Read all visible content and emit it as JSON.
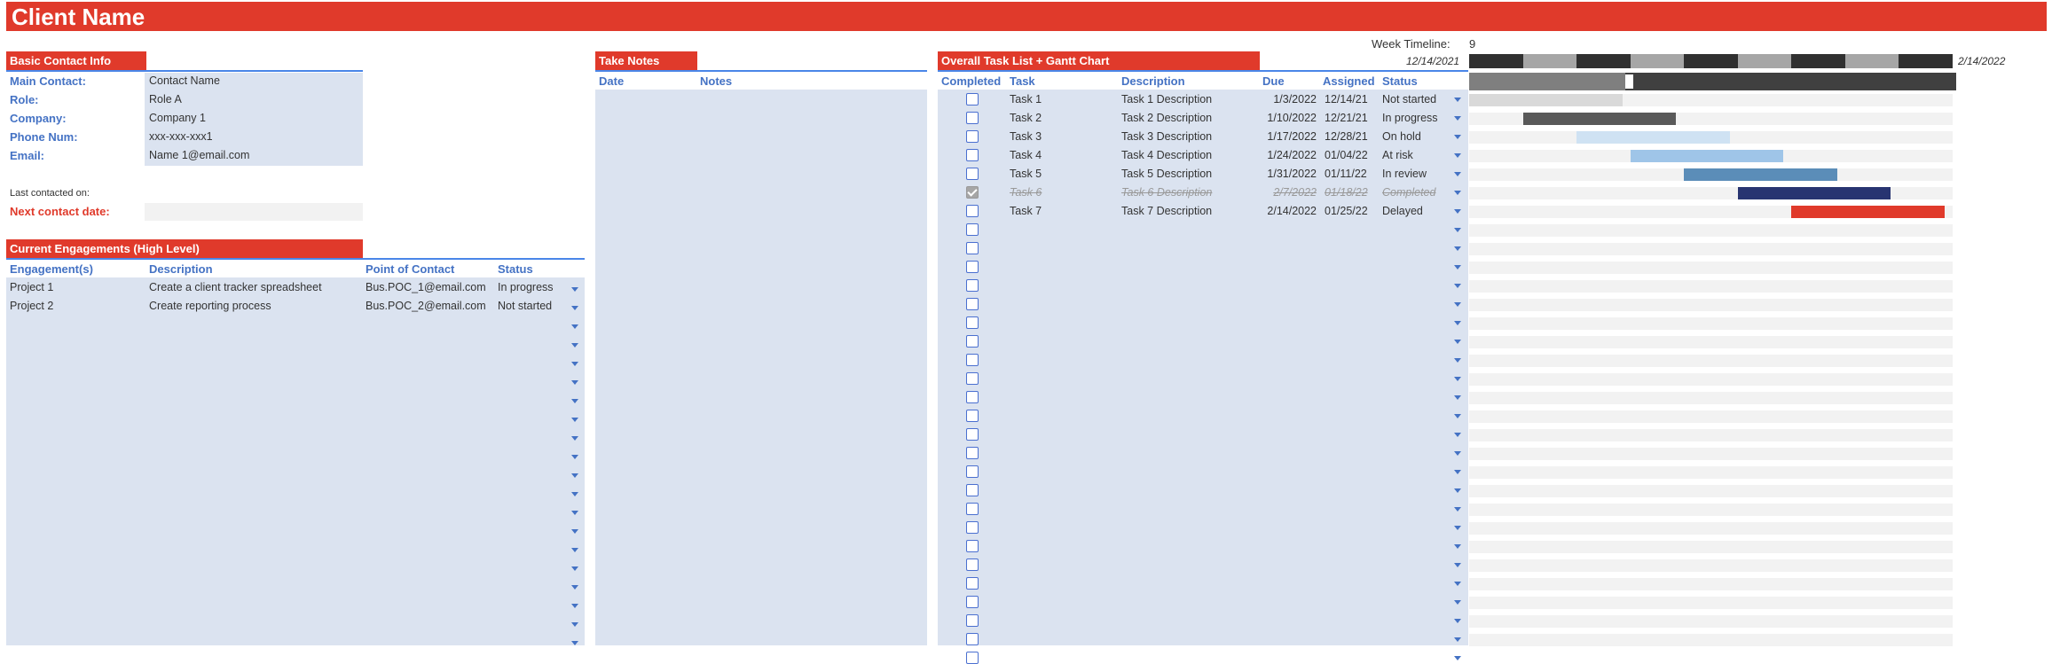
{
  "title": "Client Name",
  "contact": {
    "header": "Basic Contact Info",
    "rows": [
      {
        "label": "Main Contact:",
        "value": "Contact Name"
      },
      {
        "label": "Role:",
        "value": "Role A"
      },
      {
        "label": "Company:",
        "value": "Company 1"
      },
      {
        "label": "Phone Num:",
        "value": "xxx-xxx-xxx1"
      },
      {
        "label": "Email:",
        "value": "Name 1@email.com"
      }
    ],
    "last_contacted_label": "Last contacted on:",
    "next_contact_label": "Next contact date:"
  },
  "engagements": {
    "header": "Current Engagements (High Level)",
    "columns": [
      "Engagement(s)",
      "Description",
      "Point of Contact",
      "Status"
    ],
    "rows": [
      [
        "Project 1",
        "Create a client tracker spreadsheet",
        "Bus.POC_1@email.com",
        "In progress"
      ],
      [
        "Project 2",
        "Create reporting process",
        "Bus.POC_2@email.com",
        "Not started"
      ]
    ]
  },
  "notes": {
    "header": "Take Notes",
    "columns": [
      "Date",
      "Notes"
    ]
  },
  "tasks": {
    "header": "Overall Task List + Gantt Chart",
    "week_timeline_label": "Week Timeline:",
    "week_timeline_value": "9",
    "start_date": "12/14/2021",
    "end_date": "2/14/2022",
    "columns": [
      "Completed",
      "Task",
      "Description",
      "Due",
      "Assigned",
      "Status"
    ],
    "rows": [
      {
        "task": "Task 1",
        "description": "Task 1 Description",
        "due": "1/3/2022",
        "assigned": "12/14/21",
        "status": "Not started",
        "completed": false
      },
      {
        "task": "Task 2",
        "description": "Task 2 Description",
        "due": "1/10/2022",
        "assigned": "12/21/21",
        "status": "In progress",
        "completed": false
      },
      {
        "task": "Task 3",
        "description": "Task 3 Description",
        "due": "1/17/2022",
        "assigned": "12/28/21",
        "status": "On hold",
        "completed": false
      },
      {
        "task": "Task 4",
        "description": "Task 4 Description",
        "due": "1/24/2022",
        "assigned": "01/04/22",
        "status": "At risk",
        "completed": false
      },
      {
        "task": "Task 5",
        "description": "Task 5 Description",
        "due": "1/31/2022",
        "assigned": "01/11/22",
        "status": "In review",
        "completed": false
      },
      {
        "task": "Task 6",
        "description": "Task 6 Description",
        "due": "2/7/2022",
        "assigned": "01/18/22",
        "status": "Completed",
        "completed": true
      },
      {
        "task": "Task 7",
        "description": "Task 7 Description",
        "due": "2/14/2022",
        "assigned": "01/25/22",
        "status": "Delayed",
        "completed": false
      }
    ],
    "status_colors": {
      "Not started": "#d9d9d9",
      "In progress": "#595959",
      "On hold": "#cfe2f3",
      "At risk": "#9fc5e8",
      "In review": "#5b8db8",
      "Completed": "#283471",
      "Delayed": "#e03a2b"
    }
  },
  "colors": {
    "accent": "#e03a2b",
    "header_text": "#4472c4",
    "fill": "#dbe3f0"
  }
}
